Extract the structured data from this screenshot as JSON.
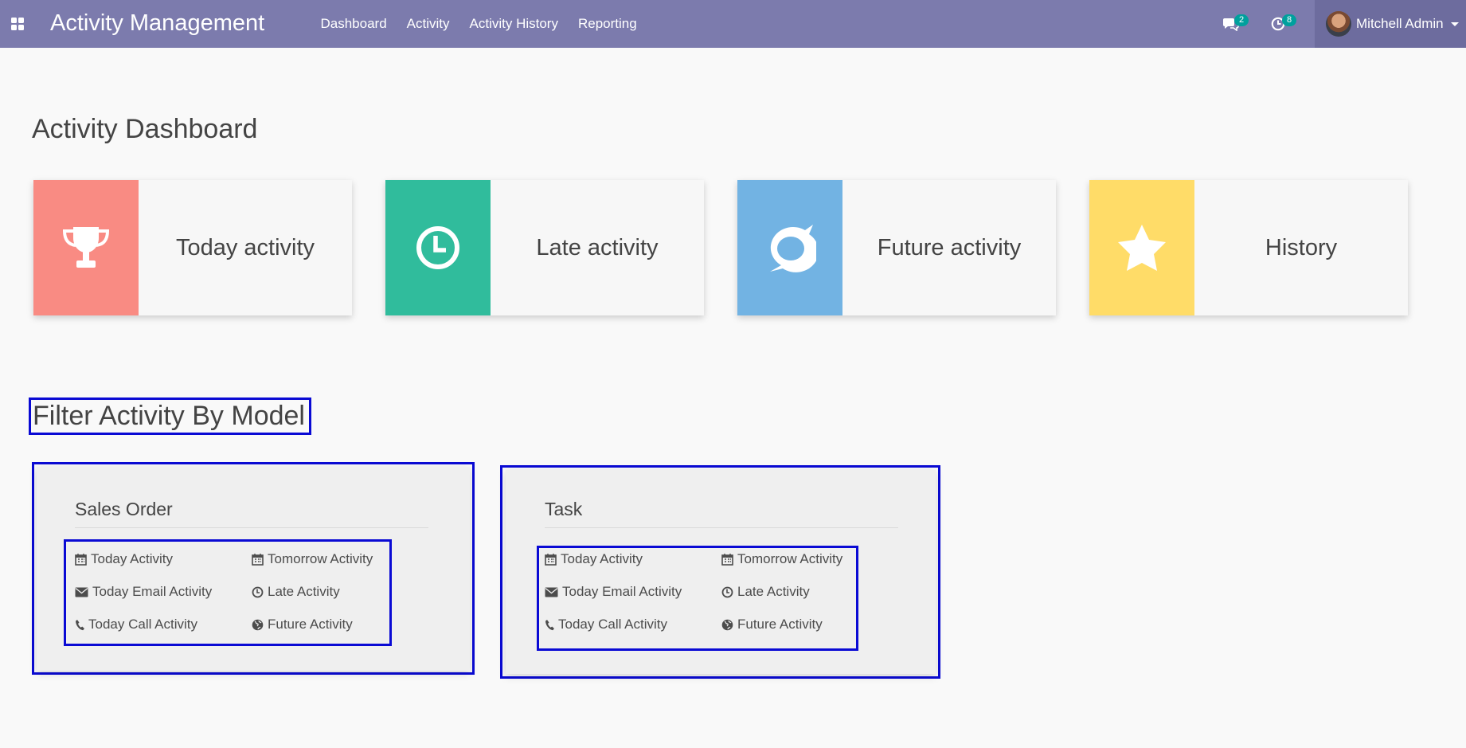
{
  "navbar": {
    "app_title": "Activity Management",
    "menu": [
      "Dashboard",
      "Activity",
      "Activity History",
      "Reporting"
    ],
    "messages_count": "2",
    "activities_count": "8",
    "user_name": "Mitchell Admin"
  },
  "page_title": "Activity Dashboard",
  "cards": [
    {
      "label": "Today activity",
      "color": "#f98b83",
      "icon": "trophy-icon"
    },
    {
      "label": "Late activity",
      "color": "#30bc9c",
      "icon": "clock-icon"
    },
    {
      "label": "Future activity",
      "color": "#72b3e3",
      "icon": "comment-icon"
    },
    {
      "label": "History",
      "color": "#ffdc68",
      "icon": "star-icon"
    }
  ],
  "filter_title": "Filter Activity By Model",
  "models": [
    {
      "title": "Sales Order",
      "activities": [
        {
          "label": "Today Activity",
          "icon": "calendar-icon"
        },
        {
          "label": "Tomorrow Activity",
          "icon": "calendar-icon"
        },
        {
          "label": "Today Email Activity",
          "icon": "envelope-icon"
        },
        {
          "label": "Late Activity",
          "icon": "clock-icon"
        },
        {
          "label": "Today Call Activity",
          "icon": "phone-icon"
        },
        {
          "label": "Future Activity",
          "icon": "globe-icon"
        }
      ]
    },
    {
      "title": "Task",
      "activities": [
        {
          "label": "Today Activity",
          "icon": "calendar-icon"
        },
        {
          "label": "Tomorrow Activity",
          "icon": "calendar-icon"
        },
        {
          "label": "Today Email Activity",
          "icon": "envelope-icon"
        },
        {
          "label": "Late Activity",
          "icon": "clock-icon"
        },
        {
          "label": "Today Call Activity",
          "icon": "phone-icon"
        },
        {
          "label": "Future Activity",
          "icon": "globe-icon"
        }
      ]
    }
  ]
}
